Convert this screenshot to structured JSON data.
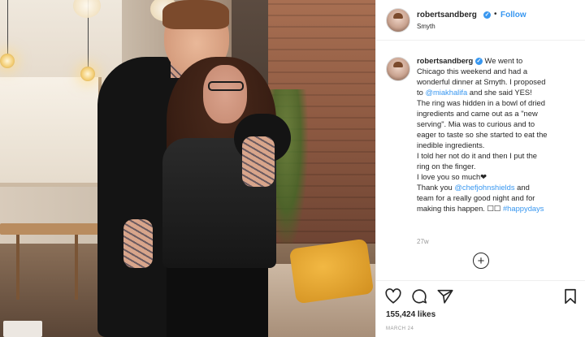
{
  "post": {
    "username": "robertsandberg",
    "follow_label": "Follow",
    "separator": "•",
    "location": "Smyth",
    "verified_mark": "✓",
    "caption": {
      "lines": [
        "We went to",
        "Chicago this weekend and had a",
        "wonderful dinner at Smyth. I proposed",
        "to",
        "and she said YES!",
        "The ring was hidden in a bowl of dried",
        "ingredients and came out as a \"new",
        "serving\". Mia was to curious and to",
        "eager to taste so she started to eat the",
        "inedible ingredients.",
        "I told her not do it and then I put the",
        "ring on the finger.",
        "I love you so much❤",
        "Thank you",
        "and",
        "team for a really good night and for",
        "making this happen. ☐☐",
        "#happydays"
      ],
      "mention_1": "@miakhalifa",
      "mention_2": "@chefjohnshields"
    },
    "age": "27w",
    "load_more_symbol": "+",
    "likes": "155,424 likes",
    "date": "MARCH 24"
  },
  "icons": {
    "like": "heart-icon",
    "comment": "comment-icon",
    "share": "share-icon",
    "save": "bookmark-icon",
    "load_more": "plus-circle-icon"
  },
  "colors": {
    "accent": "#3897f0",
    "text": "#262626",
    "muted": "#999999",
    "divider": "#efefef"
  }
}
